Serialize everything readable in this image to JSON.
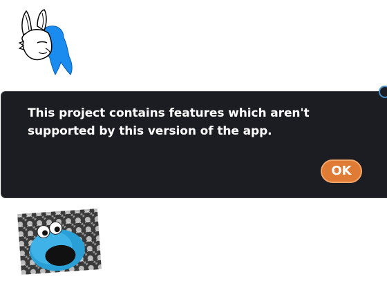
{
  "dialog": {
    "message": "This project contains features which aren't supported by this version of the app.",
    "ok_label": "OK"
  },
  "colors": {
    "dialog_background": "#1c1d22",
    "ok_button": "#e07b36",
    "fox_hair": "#1a8cf0",
    "cookie_monster": "#2a9fd6"
  },
  "sprites": {
    "top": "fox-character-sprite",
    "bottom": "cookie-monster-photo-sprite"
  }
}
